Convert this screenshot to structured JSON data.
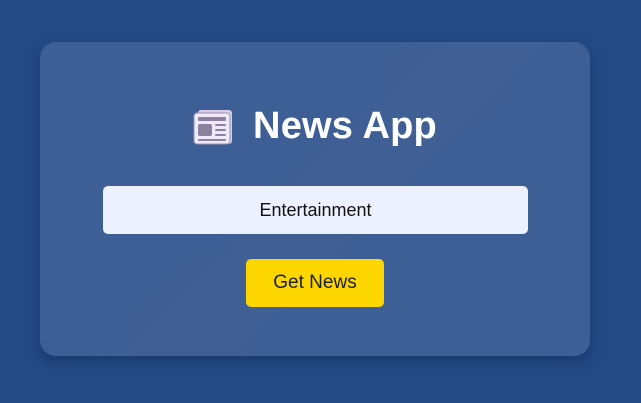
{
  "app": {
    "title": "News App",
    "icon": "newspaper-icon"
  },
  "search": {
    "value": "Entertainment"
  },
  "actions": {
    "get_news_label": "Get News"
  },
  "colors": {
    "page_background": "#244a86",
    "card_background": "#3d5f95",
    "input_background": "#edf1fd",
    "button_background": "#fdd600",
    "title_text": "#ffffff"
  }
}
